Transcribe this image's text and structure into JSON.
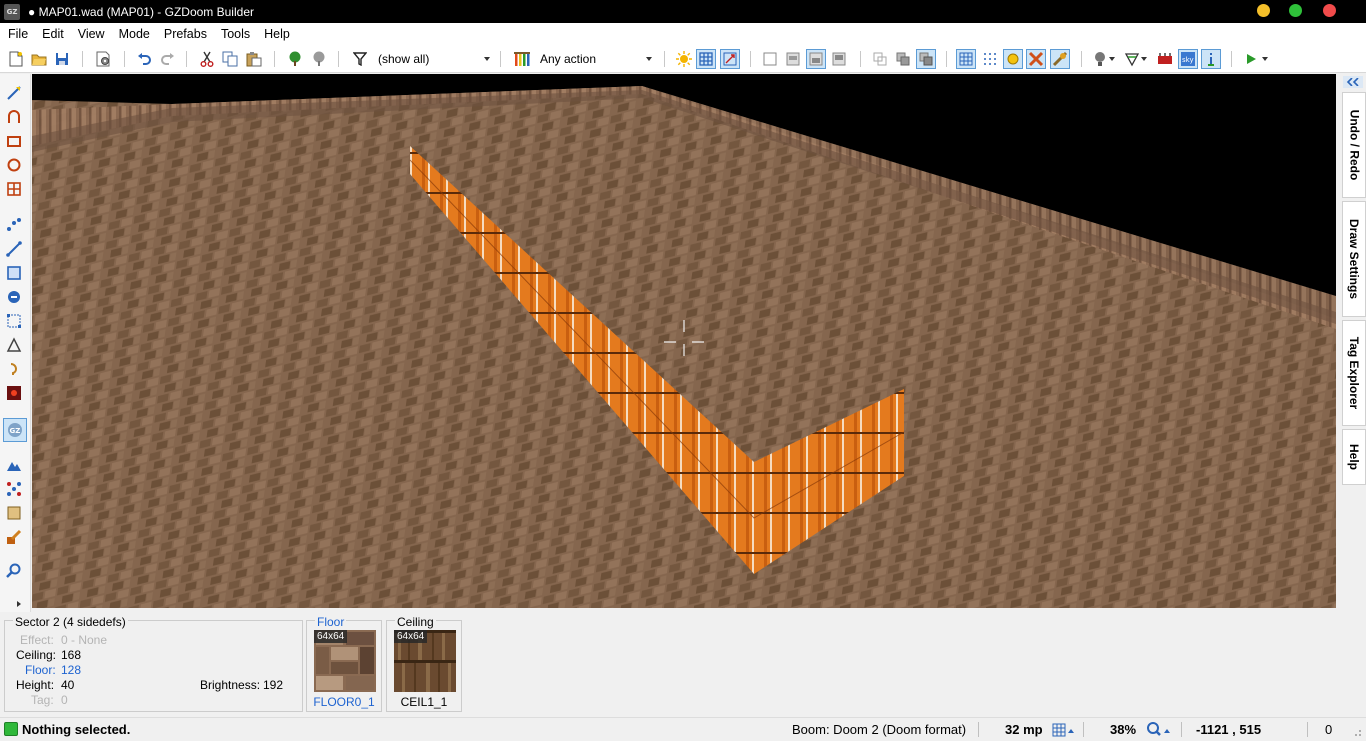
{
  "window": {
    "icon_label": "GZ",
    "title": "● MAP01.wad (MAP01) - GZDoom Builder",
    "controls": [
      "minimize-icon",
      "maximize-icon",
      "close-icon"
    ]
  },
  "menu": [
    "File",
    "Edit",
    "View",
    "Mode",
    "Prefabs",
    "Tools",
    "Help"
  ],
  "toolbar": {
    "filter_value": "(show all)",
    "action_value": "Any action"
  },
  "bottom": {
    "sector_title": "Sector 2 (4 sidedefs)",
    "effect_label": "Effect:",
    "effect_value": "0 - None",
    "ceiling_label": "Ceiling:",
    "ceiling_value": "168",
    "floor_label": "Floor:",
    "floor_value": "128",
    "height_label": "Height:",
    "height_value": "40",
    "tag_label": "Tag:",
    "tag_value": "0",
    "brightness_label": "Brightness:",
    "brightness_value": "192",
    "floor_tex": {
      "label": "Floor",
      "size": "64x64",
      "name": "FLOOR0_1"
    },
    "ceiling_tex": {
      "label": "Ceiling",
      "size": "64x64",
      "name": "CEIL1_1"
    }
  },
  "right_tabs": [
    "Undo / Redo",
    "Draw Settings",
    "Tag Explorer",
    "Help"
  ],
  "status": {
    "message": "Nothing selected.",
    "game_config": "Boom: Doom 2 (Doom format)",
    "grid": "32 mp",
    "zoom": "38%",
    "coords": "-1121 , 515",
    "counter": "0"
  },
  "colors": {
    "titlebar_bg": "#000000",
    "status_green": "#2fb83a",
    "wall_orange": "#e0761c",
    "floor_brown": "#8a6a50",
    "selection_blue": "#cce4f7"
  }
}
